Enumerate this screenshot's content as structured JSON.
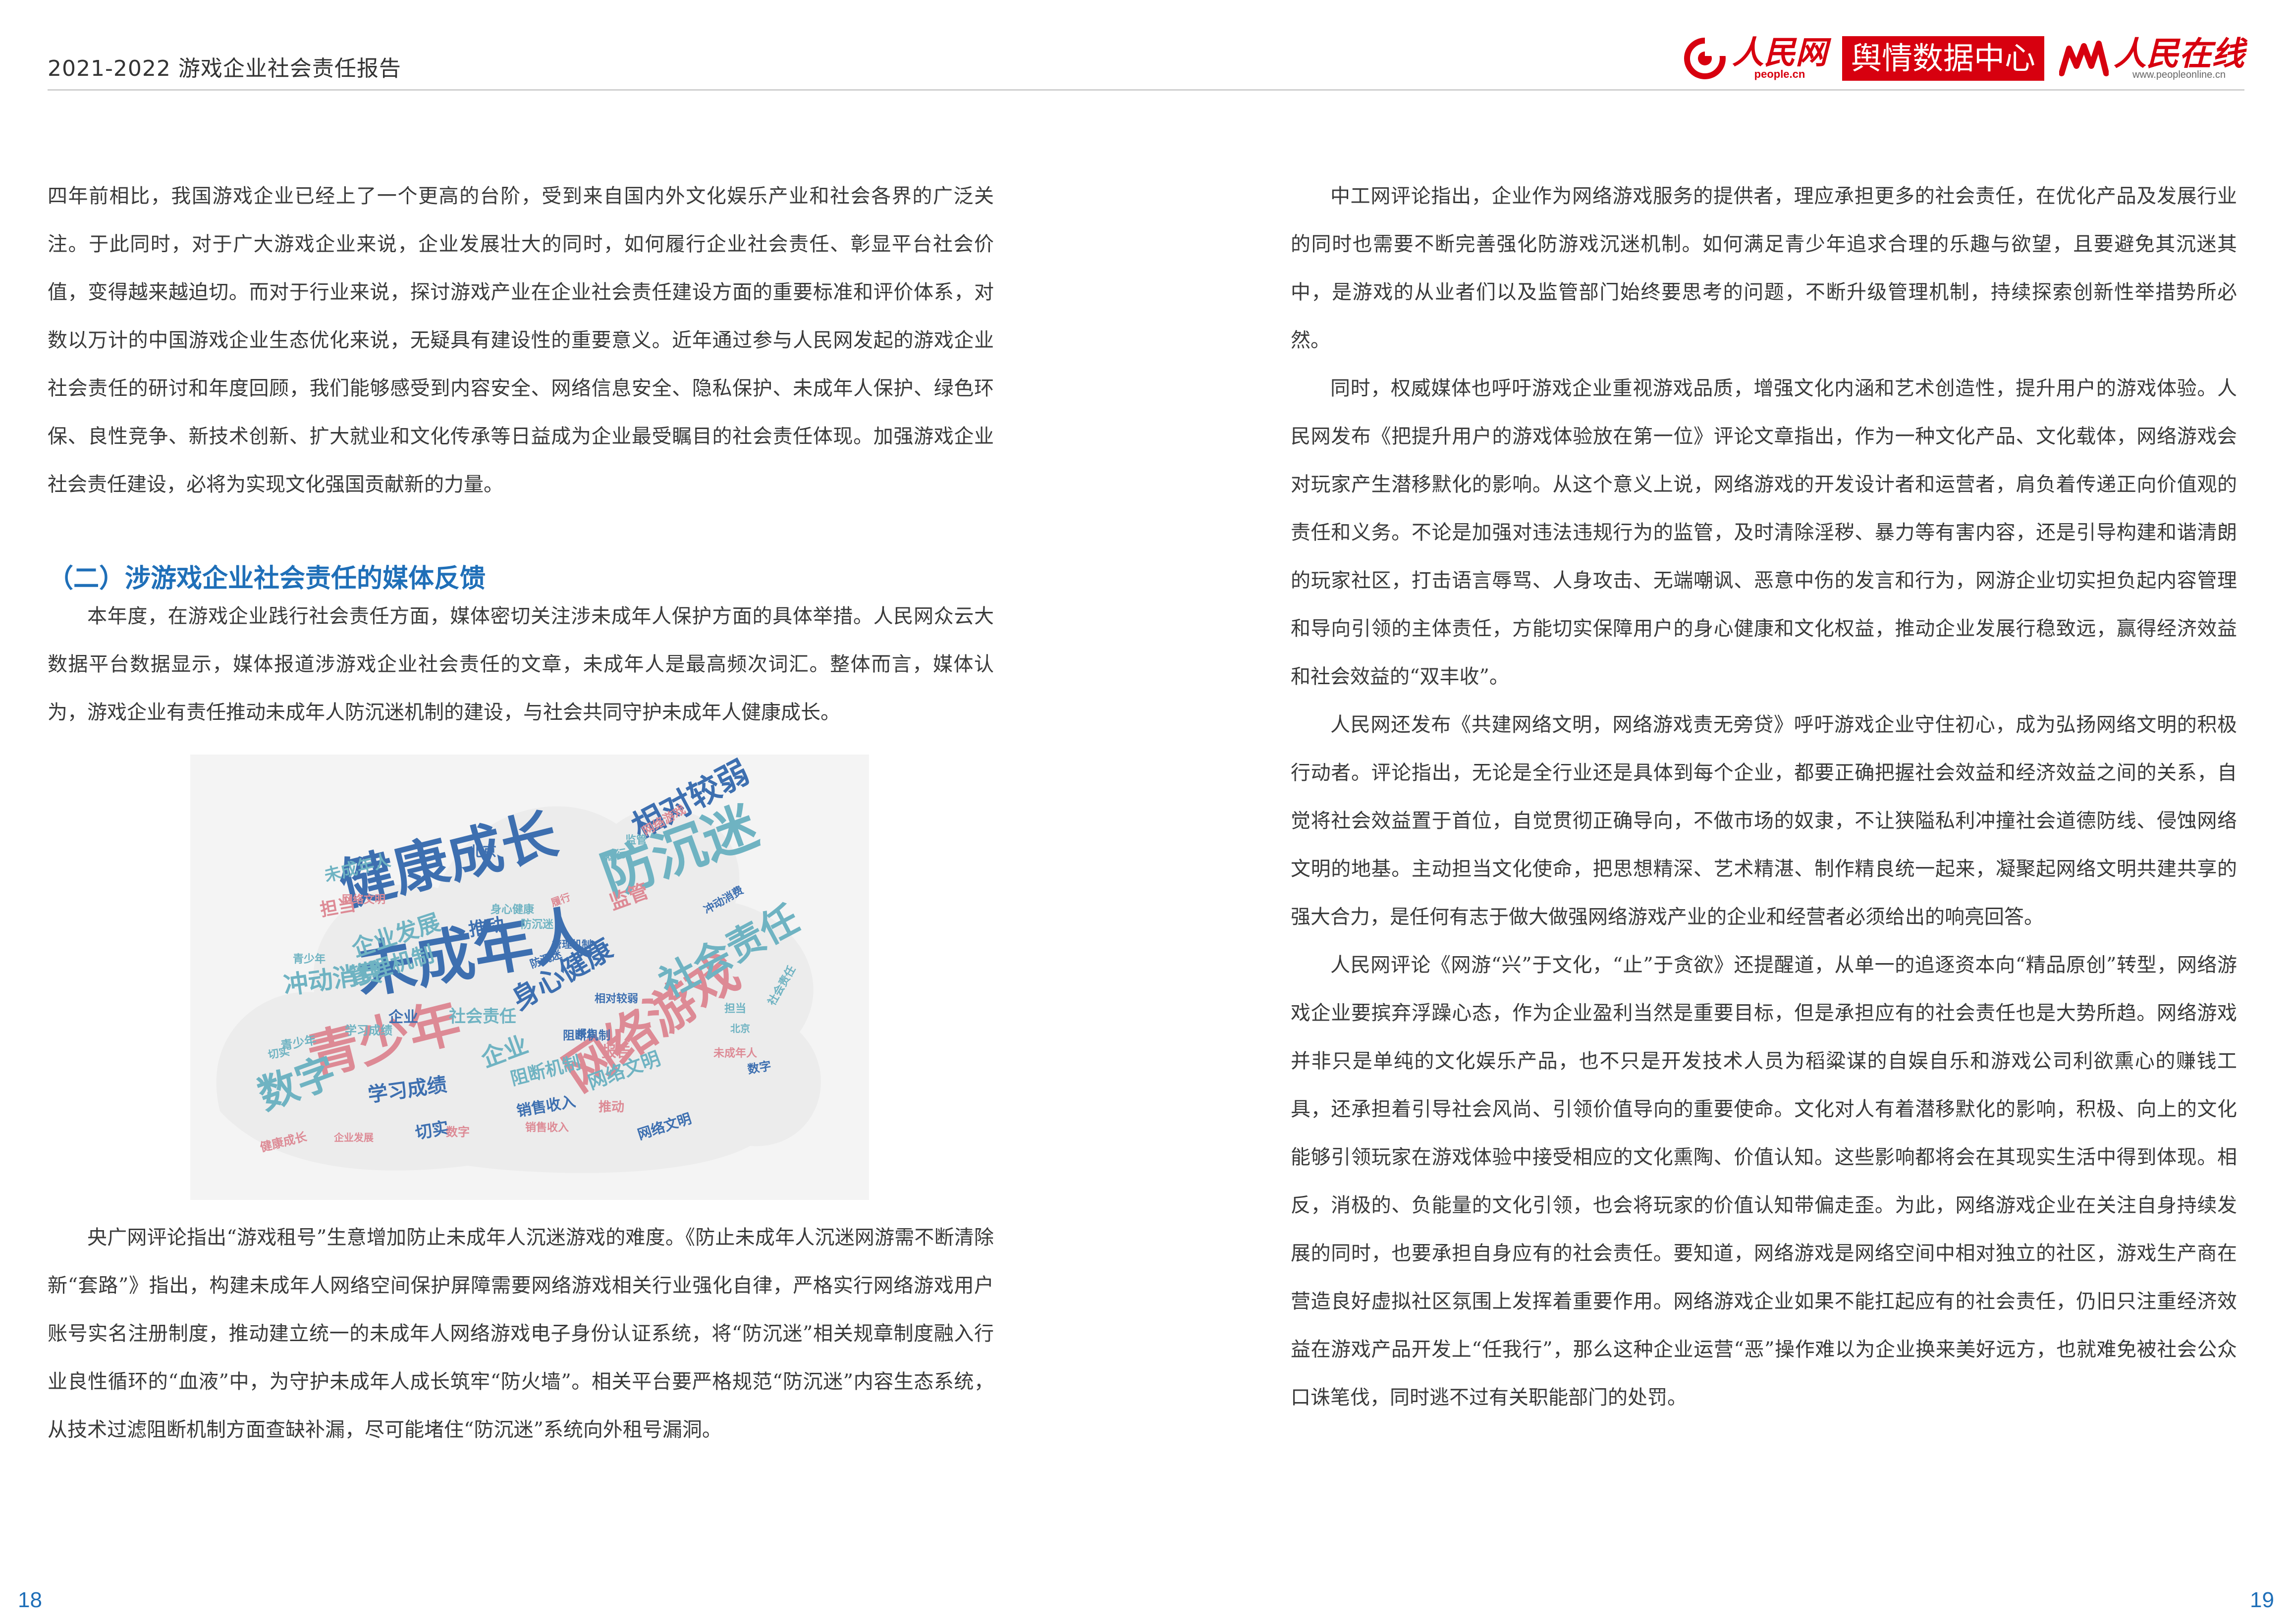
{
  "header": {
    "title": "2021-2022 游戏企业社会责任报告",
    "logo_people_cn": "人民网",
    "logo_people_url": "people.cn",
    "logo_badge": "舆情数据中心",
    "logo_online_cn": "人民在线",
    "logo_online_url": "www.peopleonline.cn",
    "brand_color": "#d7000f"
  },
  "left": {
    "para_intro": "四年前相比，我国游戏企业已经上了一个更高的台阶，受到来自国内外文化娱乐产业和社会各界的广泛关注。于此同时，对于广大游戏企业来说，企业发展壮大的同时，如何履行企业社会责任、彰显平台社会价值，变得越来越迫切。而对于行业来说，探讨游戏产业在企业社会责任建设方面的重要标准和评价体系，对数以万计的中国游戏企业生态优化来说，无疑具有建设性的重要意义。近年通过参与人民网发起的游戏企业社会责任的研讨和年度回顾，我们能够感受到内容安全、网络信息安全、隐私保护、未成年人保护、绿色环保、良性竞争、新技术创新、扩大就业和文化传承等日益成为企业最受瞩目的社会责任体现。加强游戏企业社会责任建设，必将为实现文化强国贡献新的力量。",
    "section_heading": "（二）涉游戏企业社会责任的媒体反馈",
    "para_media": "本年度，在游戏企业践行社会责任方面，媒体密切关注涉未成年人保护方面的具体举措。人民网众云大数据平台数据显示，媒体报道涉游戏企业社会责任的文章，未成年人是最高频次词汇。整体而言，媒体认为，游戏企业有责任推动未成年人防沉迷机制的建设，与社会共同守护未成年人健康成长。",
    "para_cctv": "央广网评论指出“游戏租号”生意增加防止未成年人沉迷游戏的难度。《防止未成年人沉迷网游需不断清除新“套路”》指出，构建未成年人网络空间保护屏障需要网络游戏相关行业强化自律，严格实行网络游戏用户账号实名注册制度，推动建立统一的未成年人网络游戏电子身份认证系统，将“防沉迷”相关规章制度融入行业良性循环的“血液”中，为守护未成年人成长筑牢“防火墙”。相关平台要严格规范“防沉迷”内容生态系统，从技术过滤阻断机制方面查缺补漏，尽可能堵住“防沉迷”系统向外租号漏洞。"
  },
  "right": {
    "para_1": "中工网评论指出，企业作为网络游戏服务的提供者，理应承担更多的社会责任，在优化产品及发展行业的同时也需要不断完善强化防游戏沉迷机制。如何满足青少年追求合理的乐趣与欲望，且要避免其沉迷其中，是游戏的从业者们以及监管部门始终要思考的问题，不断升级管理机制，持续探索创新性举措势所必然。",
    "para_2": "同时，权威媒体也呼吁游戏企业重视游戏品质，增强文化内涵和艺术创造性，提升用户的游戏体验。人民网发布《把提升用户的游戏体验放在第一位》评论文章指出，作为一种文化产品、文化载体，网络游戏会对玩家产生潜移默化的影响。从这个意义上说，网络游戏的开发设计者和运营者，肩负着传递正向价值观的责任和义务。不论是加强对违法违规行为的监管，及时清除淫秽、暴力等有害内容，还是引导构建和谐清朗的玩家社区，打击语言辱骂、人身攻击、无端嘲讽、恶意中伤的发言和行为，网游企业切实担负起内容管理和导向引领的主体责任，方能切实保障用户的身心健康和文化权益，推动企业发展行稳致远，赢得经济效益和社会效益的“双丰收”。",
    "para_3": "人民网还发布《共建网络文明，网络游戏责无旁贷》呼吁游戏企业守住初心，成为弘扬网络文明的积极行动者。评论指出，无论是全行业还是具体到每个企业，都要正确把握社会效益和经济效益之间的关系，自觉将社会效益置于首位，自觉贯彻正确导向，不做市场的奴隶，不让狭隘私利冲撞社会道德防线、侵蚀网络文明的地基。主动担当文化使命，把思想精深、艺术精湛、制作精良统一起来，凝聚起网络文明共建共享的强大合力，是任何有志于做大做强网络游戏产业的企业和经营者必须给出的响亮回答。",
    "para_4": "人民网评论《网游“兴”于文化，“止”于贪欲》还提醒道，从单一的追逐资本向“精品原创”转型，网络游戏企业要摈弃浮躁心态，作为企业盈利当然是重要目标，但是承担应有的社会责任也是大势所趋。网络游戏并非只是单纯的文化娱乐产品，也不只是开发技术人员为稻粱谋的自娱自乐和游戏公司利欲熏心的赚钱工具，还承担着引导社会风尚、引领价值导向的重要使命。文化对人有着潜移默化的影响，积极、向上的文化能够引领玩家在游戏体验中接受相应的文化熏陶、价值认知。这些影响都将会在其现实生活中得到体现。相反，消极的、负能量的文化引领，也会将玩家的价值认知带偏走歪。为此，网络游戏企业在关注自身持续发展的同时，也要承担自身应有的社会责任。要知道，网络游戏是网络空间中相对独立的社区，游戏生产商在营造良好虚拟社区氛围上发挥着重要作用。网络游戏企业如果不能扛起应有的社会责任，仍旧只注重经济效益在游戏产品开发上“任我行”，那么这种企业运营“恶”操作难以为企业换来美好远方，也就难免被社会公众口诛笔伐，同时逃不过有关职能部门的处罚。"
  },
  "wordcloud": {
    "colors": {
      "blue": "#3d6fb0",
      "teal": "#6fb3c2",
      "pink": "#dd8a95",
      "gray": "#7d8fa3"
    },
    "words": [
      {
        "text": "未成年人",
        "color": "blue"
      },
      {
        "text": "健康成长",
        "color": "blue"
      },
      {
        "text": "防沉迷",
        "color": "teal"
      },
      {
        "text": "青少年",
        "color": "pink"
      },
      {
        "text": "网络游戏",
        "color": "pink"
      },
      {
        "text": "数字",
        "color": "teal"
      },
      {
        "text": "相对较弱",
        "color": "blue"
      },
      {
        "text": "社会责任",
        "color": "teal"
      },
      {
        "text": "身心健康",
        "color": "blue"
      },
      {
        "text": "冲动消费",
        "color": "teal"
      },
      {
        "text": "企业发展",
        "color": "teal"
      },
      {
        "text": "管理机制",
        "color": "teal"
      },
      {
        "text": "学习成绩",
        "color": "blue"
      },
      {
        "text": "网络文明",
        "color": "teal"
      },
      {
        "text": "企业",
        "color": "teal"
      },
      {
        "text": "销售收入",
        "color": "blue"
      },
      {
        "text": "未成年人",
        "color": "teal"
      },
      {
        "text": "推动",
        "color": "blue"
      },
      {
        "text": "担当",
        "color": "pink"
      },
      {
        "text": "监管",
        "color": "pink"
      },
      {
        "text": "切实",
        "color": "blue"
      },
      {
        "text": "阻断机制",
        "color": "teal"
      },
      {
        "text": "北京",
        "color": "blue"
      },
      {
        "text": "报告",
        "color": "pink"
      },
      {
        "text": "社会责任",
        "color": "teal"
      },
      {
        "text": "健康成长",
        "color": "pink"
      },
      {
        "text": "网络游戏",
        "color": "pink"
      },
      {
        "text": "网络文明",
        "color": "blue"
      },
      {
        "text": "履行",
        "color": "teal"
      },
      {
        "text": "防沉迷",
        "color": "teal"
      },
      {
        "text": "青少年",
        "color": "teal"
      },
      {
        "text": "数字",
        "color": "pink"
      },
      {
        "text": "冲动消费",
        "color": "blue"
      },
      {
        "text": "企业",
        "color": "blue"
      },
      {
        "text": "推动",
        "color": "pink"
      },
      {
        "text": "阻断机制",
        "color": "blue"
      },
      {
        "text": "学习成绩",
        "color": "teal"
      },
      {
        "text": "社会责任",
        "color": "teal"
      },
      {
        "text": "相对较弱",
        "color": "blue"
      },
      {
        "text": "防沉迷",
        "color": "blue"
      },
      {
        "text": "管理机制",
        "color": "blue"
      },
      {
        "text": "未成年人",
        "color": "pink"
      },
      {
        "text": "切实",
        "color": "teal"
      },
      {
        "text": "担当",
        "color": "teal"
      },
      {
        "text": "北京",
        "color": "teal"
      },
      {
        "text": "监管",
        "color": "teal"
      },
      {
        "text": "数字",
        "color": "blue"
      },
      {
        "text": "报告",
        "color": "blue"
      },
      {
        "text": "身心健康",
        "color": "teal"
      },
      {
        "text": "销售收入",
        "color": "pink"
      },
      {
        "text": "企业发展",
        "color": "pink"
      },
      {
        "text": "履行",
        "color": "pink"
      },
      {
        "text": "网络文明",
        "color": "pink"
      },
      {
        "text": "青少年",
        "color": "teal"
      }
    ]
  },
  "page_numbers": {
    "left": "18",
    "right": "19"
  }
}
